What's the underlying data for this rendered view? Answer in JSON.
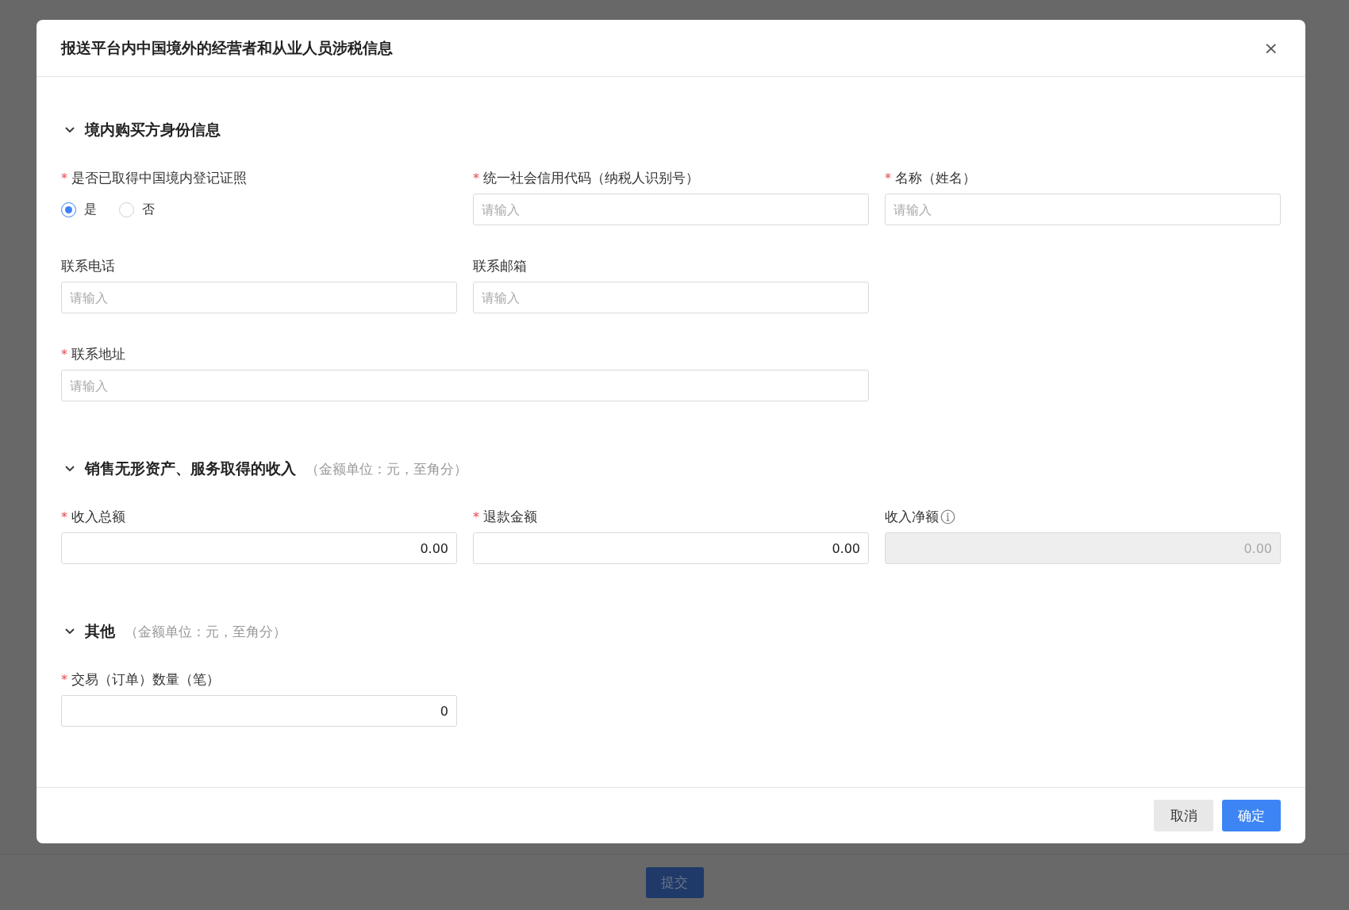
{
  "page": {
    "submit_button": "提交"
  },
  "dialog": {
    "title": "报送平台内中国境外的经营者和从业人员涉税信息",
    "close": "×",
    "sections": [
      {
        "title": "境内购买方身份信息",
        "expanded": true,
        "rows": [
          [
            {
              "kind": "radio",
              "label": "是否已取得中国境内登记证照",
              "required_mark": "*",
              "options": [
                {
                  "label": "是",
                  "selected": true
                },
                {
                  "label": "否",
                  "selected": false
                }
              ]
            },
            {
              "kind": "input",
              "label": "统一社会信用代码（纳税人识别号）",
              "required_mark": "*",
              "placeholder": "请输入"
            },
            {
              "kind": "input",
              "label": "名称（姓名）",
              "required_mark": "*",
              "placeholder": "请输入"
            }
          ],
          [
            {
              "kind": "input",
              "label": "联系电话",
              "placeholder": "请输入"
            },
            {
              "kind": "input",
              "label": "联系邮箱",
              "placeholder": "请输入"
            }
          ],
          [
            {
              "kind": "input",
              "label": "联系地址",
              "required_mark": "*",
              "placeholder": "请输入",
              "wide": true
            }
          ]
        ]
      },
      {
        "title": "销售无形资产、服务取得的收入",
        "note": "（金额单位：元，至角分）",
        "expanded": true,
        "rows": [
          [
            {
              "kind": "number",
              "label": "收入总额",
              "required_mark": "*",
              "value": "0.00"
            },
            {
              "kind": "number",
              "label": "退款金额",
              "required_mark": "*",
              "value": "0.00"
            },
            {
              "kind": "number",
              "label": "收入净额",
              "value": "0.00",
              "disabled": true,
              "info": true
            }
          ]
        ]
      },
      {
        "title": "其他",
        "note": "（金额单位：元，至角分）",
        "expanded": true,
        "rows": [
          [
            {
              "kind": "number",
              "label": "交易（订单）数量（笔）",
              "required_mark": "*",
              "value": "0"
            }
          ]
        ]
      }
    ],
    "buttons": [
      {
        "label": "取消",
        "kind": "secondary"
      },
      {
        "label": "确定",
        "kind": "primary"
      }
    ]
  }
}
